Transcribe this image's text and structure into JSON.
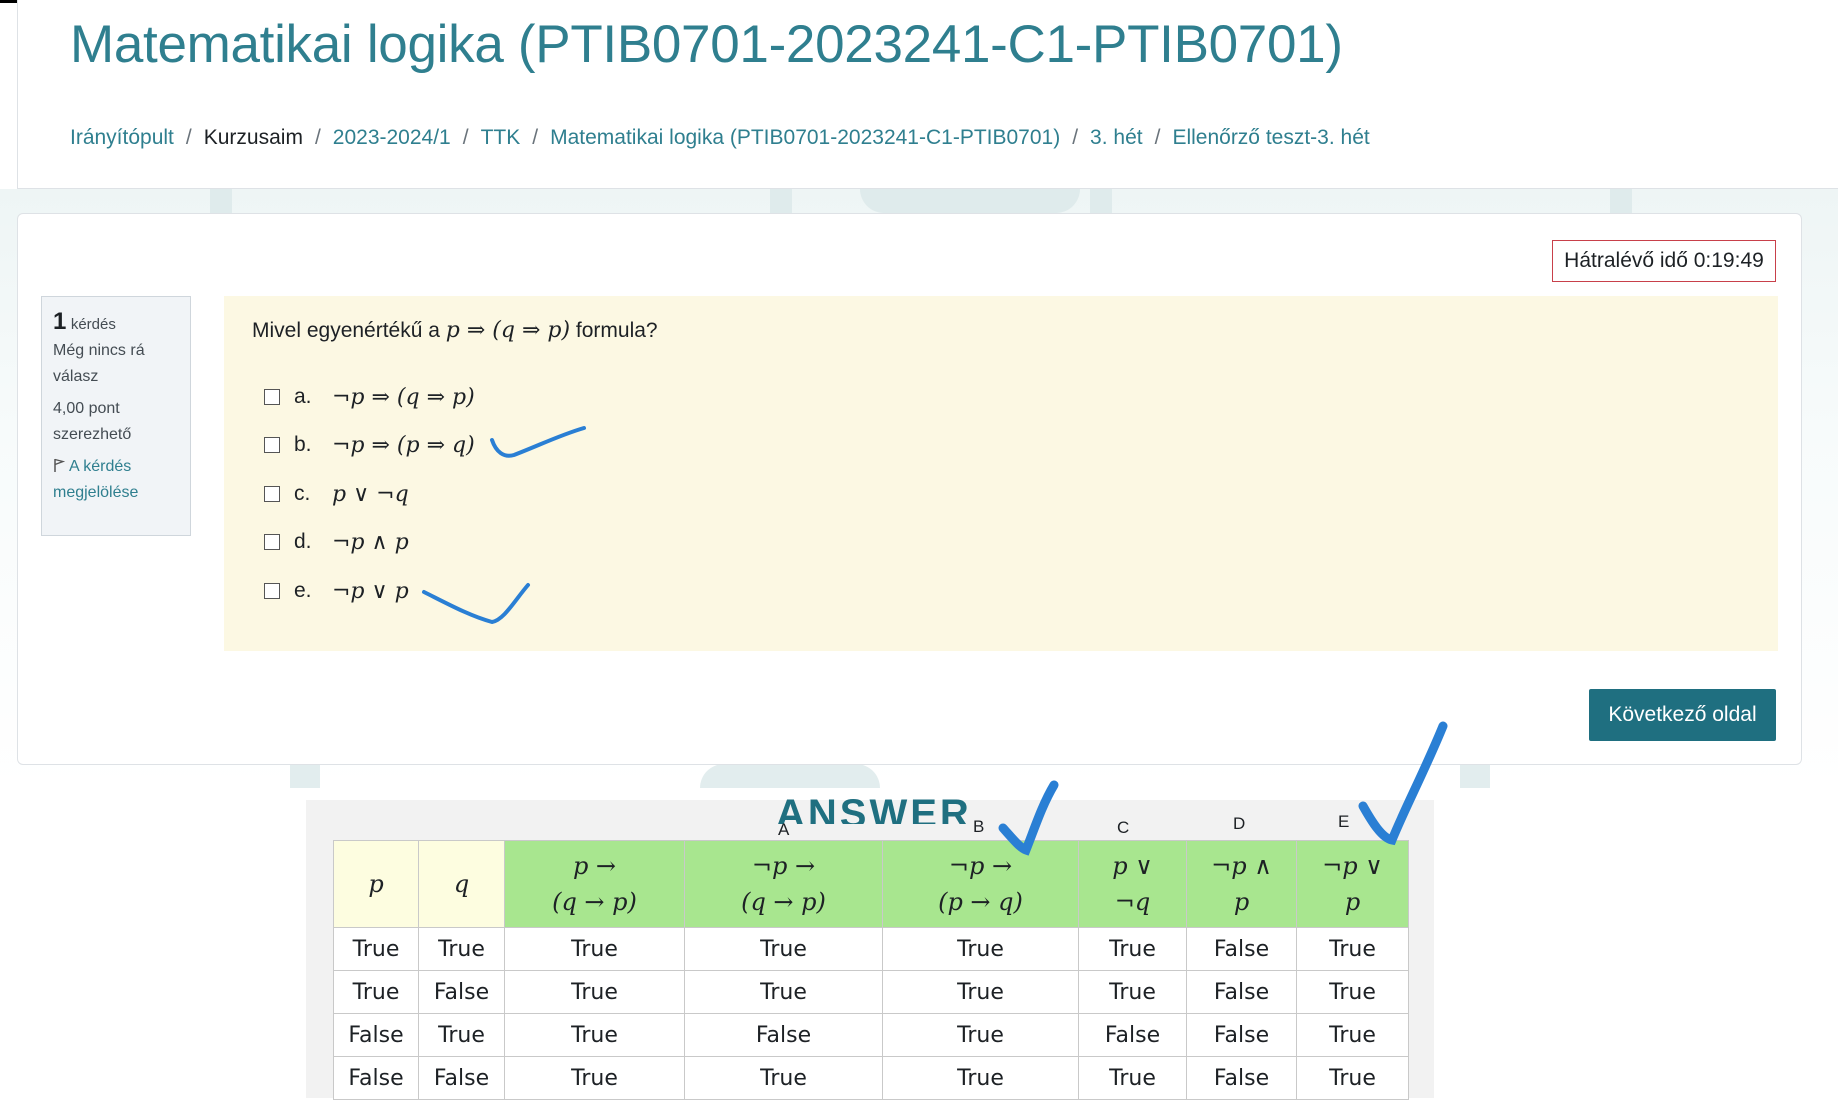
{
  "page": {
    "title": "Matematikai logika (PTIB0701-2023241-C1-PTIB0701)",
    "breadcrumb": [
      "Irányítópult",
      "Kurzusaim",
      "2023-2024/1",
      "TTK",
      "Matematikai logika (PTIB0701-2023241-C1-PTIB0701)",
      "3. hét",
      "Ellenőrző teszt-3. hét"
    ]
  },
  "timer": {
    "label": "Hátralévő idő 0:19:49"
  },
  "question_info": {
    "number": "1",
    "number_label": "kérdés",
    "status_line1": "Még nincs rá",
    "status_line2": "válasz",
    "points_line1": "4,00 pont",
    "points_line2": "szerezhető",
    "flag_line1": "A kérdés",
    "flag_line2": "megjelölése",
    "flag_icon": "flag-icon"
  },
  "question": {
    "prefix": "Mivel egyenértékű a",
    "formula": "p ⇒ (q ⇒ p)",
    "suffix": "formula?",
    "options": [
      {
        "letter": "a.",
        "formula": "¬p ⇒ (q ⇒ p)",
        "checked": false
      },
      {
        "letter": "b.",
        "formula": "¬p ⇒ (p ⇒ q)",
        "checked": false
      },
      {
        "letter": "c.",
        "formula": "p ∨ ¬q",
        "checked": false
      },
      {
        "letter": "d.",
        "formula": "¬p ∧ p",
        "checked": false
      },
      {
        "letter": "e.",
        "formula": "¬p ∨ p",
        "checked": false
      }
    ]
  },
  "next_button": {
    "label": "Következő oldal"
  },
  "answer": {
    "title": "ANSWER",
    "column_letters": [
      "A",
      "B",
      "C",
      "D",
      "E"
    ],
    "headers": [
      {
        "line1": "p",
        "line2": ""
      },
      {
        "line1": "q",
        "line2": ""
      },
      {
        "line1": "p →",
        "line2": "(q → p)"
      },
      {
        "line1": "¬p →",
        "line2": "(q → p)"
      },
      {
        "line1": "¬p →",
        "line2": "(p → q)"
      },
      {
        "line1": "p ∨",
        "line2": "¬q"
      },
      {
        "line1": "¬p ∧",
        "line2": "p"
      },
      {
        "line1": "¬p ∨",
        "line2": "p"
      }
    ],
    "rows": [
      [
        "True",
        "True",
        "True",
        "True",
        "True",
        "True",
        "False",
        "True"
      ],
      [
        "True",
        "False",
        "True",
        "True",
        "True",
        "True",
        "False",
        "True"
      ],
      [
        "False",
        "True",
        "True",
        "False",
        "True",
        "False",
        "False",
        "True"
      ],
      [
        "False",
        "False",
        "True",
        "True",
        "True",
        "True",
        "False",
        "True"
      ]
    ]
  },
  "colors": {
    "accent": "#2f7f8f",
    "button": "#1f6f80",
    "question_bg": "#fcf8e3",
    "timer_border": "#c8404a",
    "header_green": "#a8e68f",
    "header_yellow": "#fdfde0",
    "annotation_blue": "#2a7fd4"
  }
}
